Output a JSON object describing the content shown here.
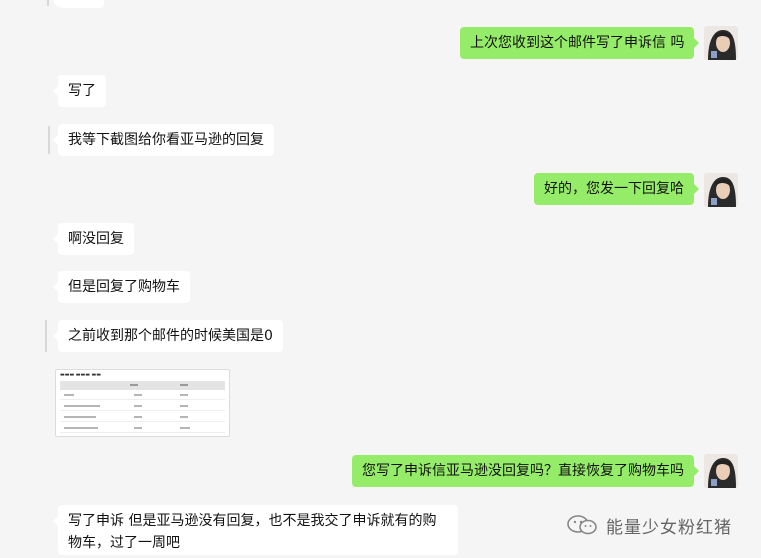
{
  "messages": [
    {
      "side": "in",
      "text": ""
    },
    {
      "side": "out",
      "text": "上次您收到这个邮件写了申诉信 吗"
    },
    {
      "side": "in",
      "text": "写了"
    },
    {
      "side": "in",
      "text": "我等下截图给你看亚马逊的回复"
    },
    {
      "side": "out",
      "text": "好的，您发一下回复哈"
    },
    {
      "side": "in",
      "text": "啊没回复"
    },
    {
      "side": "in",
      "text": "但是回复了购物车"
    },
    {
      "side": "in",
      "text": "之前收到那个邮件的时候美国是0"
    },
    {
      "side": "out",
      "text": "您写了申诉信亚马逊没回复吗？直接恢复了购物车吗"
    },
    {
      "side": "in",
      "text": "写了申诉 但是亚马逊没有回复，也不是我交了申诉就有的购物车，过了一周吧"
    }
  ],
  "thumbnail": {
    "kind": "image",
    "description_icon": "screenshot-image-icon"
  },
  "watermark": {
    "text": "能量少女粉红猪",
    "icon": "wechat-official-icon"
  },
  "colors": {
    "background": "#f5f5f5",
    "incoming": "#ffffff",
    "outgoing": "#95ec69"
  }
}
